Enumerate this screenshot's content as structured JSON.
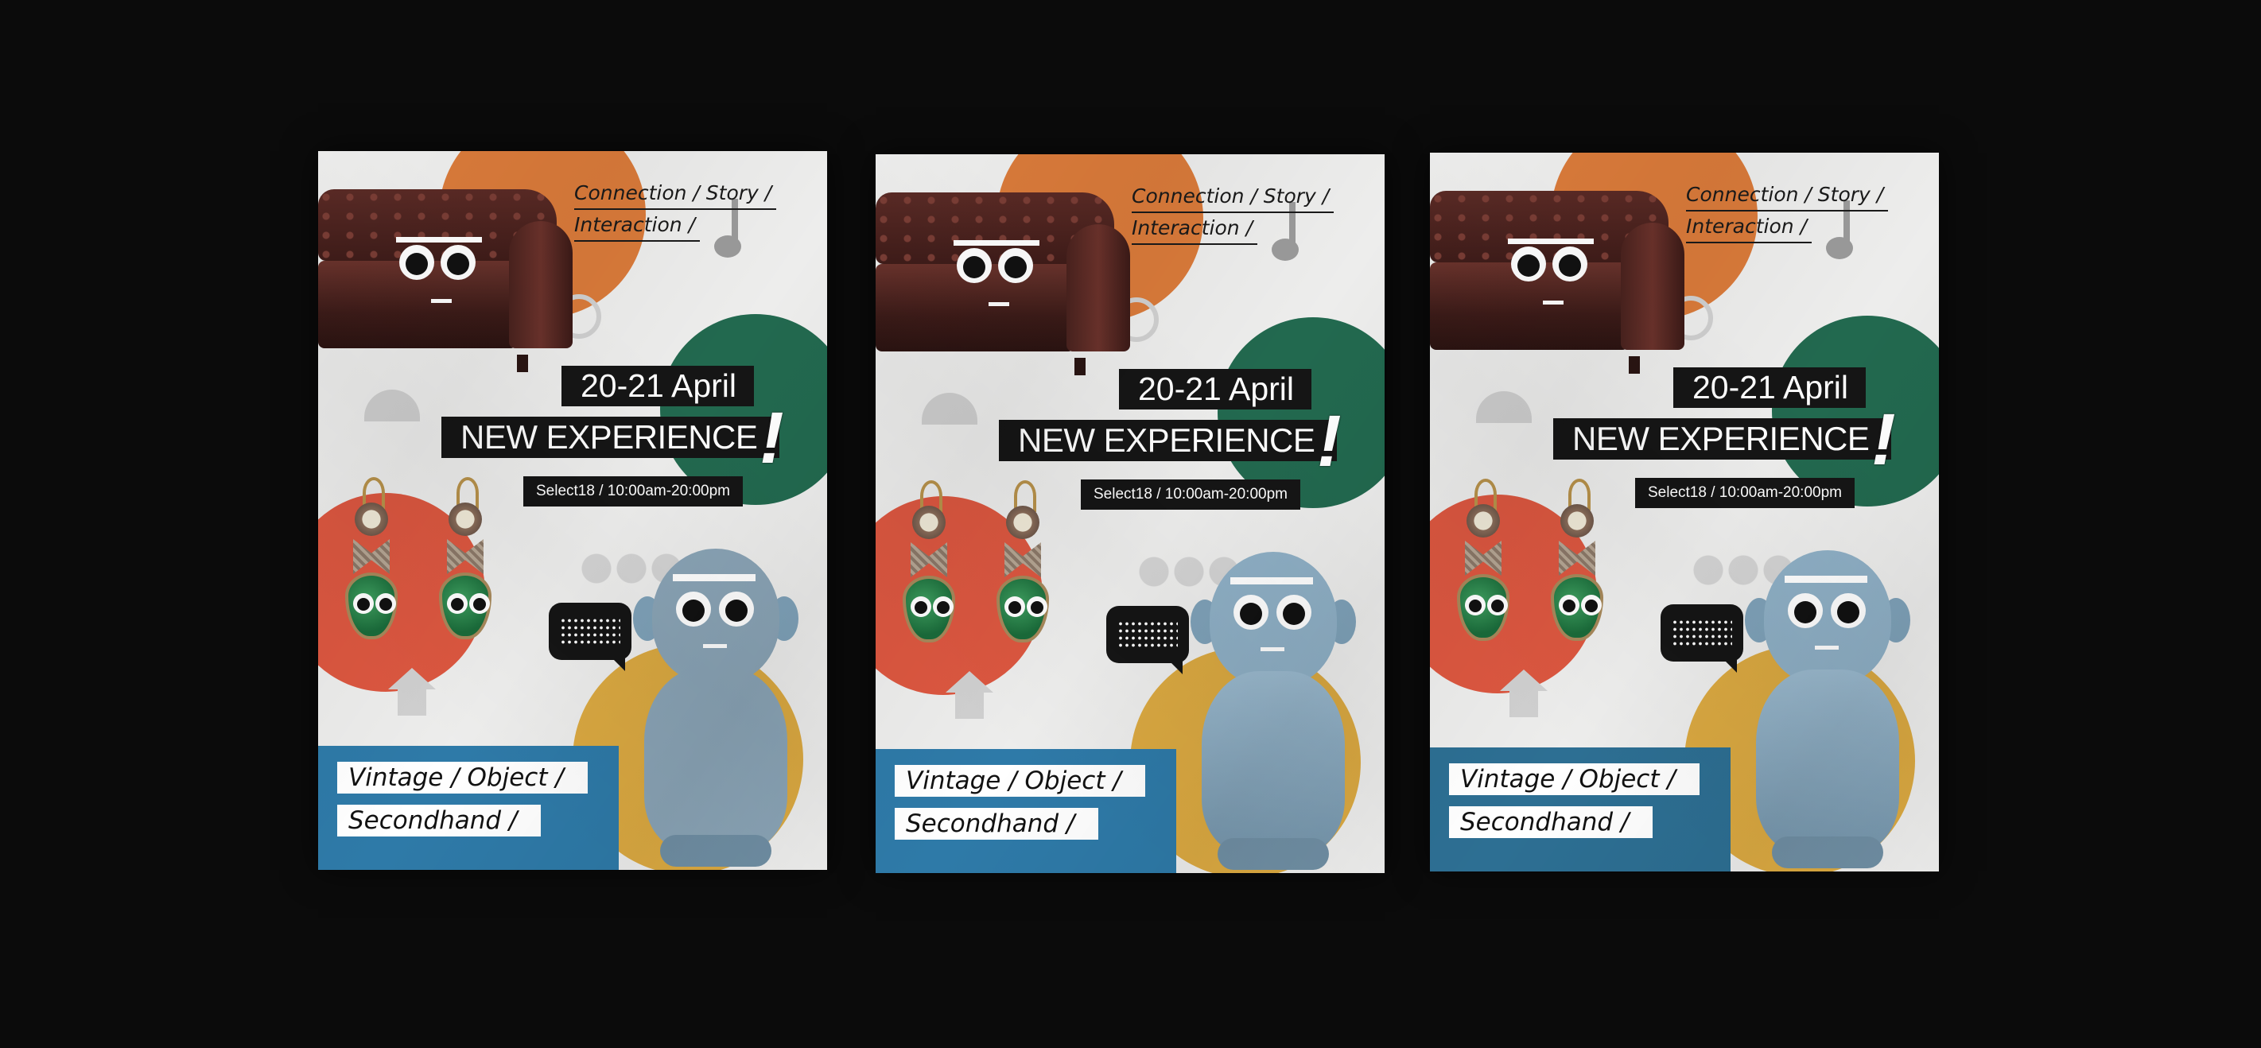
{
  "posters": [
    {
      "tagline": [
        "Connection / Story /",
        "Interaction /"
      ],
      "date": "20-21 April",
      "headline": "NEW EXPERIENCE",
      "exclaim": "!",
      "details": "Select18 / 10:00am-20:00pm",
      "categories": [
        "Vintage / Object /",
        "Secondhand /"
      ]
    },
    {
      "tagline": [
        "Connection / Story /",
        "Interaction /"
      ],
      "date": "20-21 April",
      "headline": "NEW EXPERIENCE",
      "exclaim": "!",
      "details": "Select18 / 10:00am-20:00pm",
      "categories": [
        "Vintage / Object /",
        "Secondhand /"
      ]
    },
    {
      "tagline": [
        "Connection / Story /",
        "Interaction /"
      ],
      "date": "20-21 April",
      "headline": "NEW EXPERIENCE",
      "exclaim": "!",
      "details": "Select18 / 10:00am-20:00pm",
      "categories": [
        "Vintage / Object /",
        "Secondhand /"
      ]
    }
  ],
  "colors": {
    "background": "#0b0b0b",
    "orange": "#d97a3a",
    "green": "#22694f",
    "red": "#dc5740",
    "yellow": "#dba941",
    "blue": "#2e7aa8",
    "label_black": "#151515"
  }
}
